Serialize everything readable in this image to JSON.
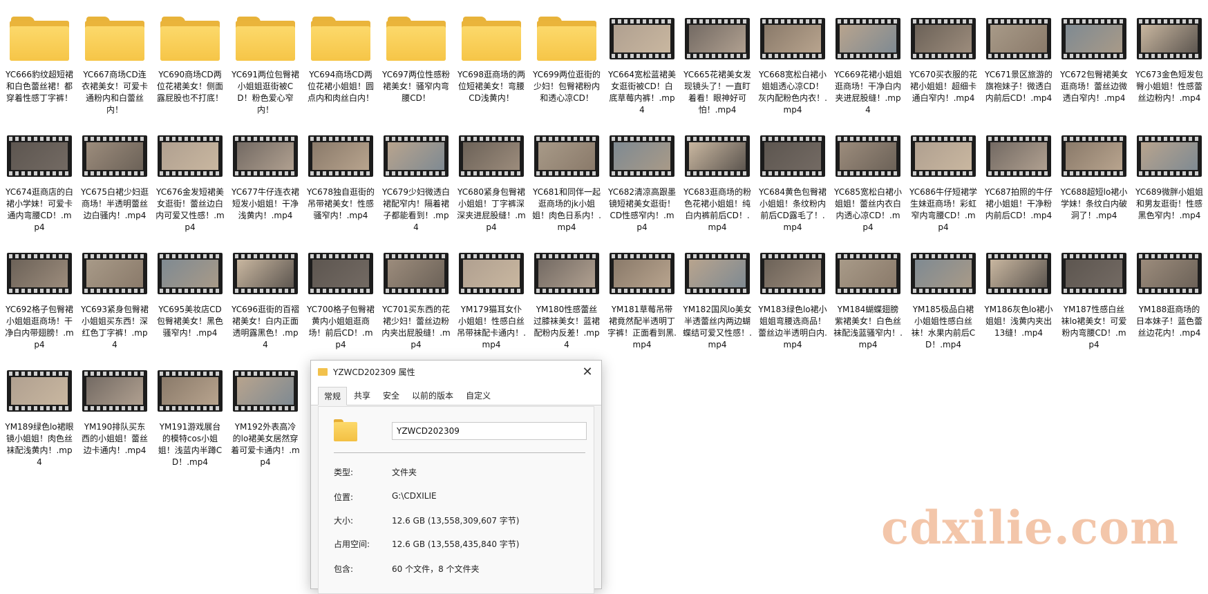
{
  "colors": {
    "folder": "#f6c547",
    "film": "#1c1c1c",
    "watermark": "#f2c0a1"
  },
  "items": [
    {
      "type": "folder",
      "label": "YC666豹纹超短裙和白色蕾丝裙！都穿着性感丁字裤！"
    },
    {
      "type": "folder",
      "label": "YC667商场CD连衣裙美女！可爱卡通粉内和白蕾丝内！"
    },
    {
      "type": "folder",
      "label": "YC690商场CD两位花裙美女！侧面露屁股也不打底！"
    },
    {
      "type": "folder",
      "label": "YC691两位包臀裙小姐姐逛街被CD！粉色爱心窄内！"
    },
    {
      "type": "folder",
      "label": "YC694商场CD两位花裙小姐姐！圆点内和肉丝白内！"
    },
    {
      "type": "folder",
      "label": "YC697两位性感粉裙美女！骚窄内弯腰CD！"
    },
    {
      "type": "folder",
      "label": "YC698逛商场的两位短裙美女！弯腰CD浅黄内！"
    },
    {
      "type": "folder",
      "label": "YC699两位逛街的少妇！包臀裙粉内和透心凉CD！"
    },
    {
      "type": "video",
      "label": "YC664宽松蓝裙美女逛街被CD！白底草莓内裤！.mp4"
    },
    {
      "type": "video",
      "label": "YC665花裙美女发现镜头了！一直盯着看！眼神好可怕！.mp4"
    },
    {
      "type": "video",
      "label": "YC668宽松白裙小姐姐透心凉CD！灰内配粉色内衣！.mp4"
    },
    {
      "type": "video",
      "label": "YC669花裙小姐姐逛商场！干净白内夹进屁股缝！.mp4"
    },
    {
      "type": "video",
      "label": "YC670买衣服的花裙小姐姐！超细卡通白窄内！.mp4"
    },
    {
      "type": "video",
      "label": "YC671景区旅游的旗袍妹子！微透白内前后CD！.mp4"
    },
    {
      "type": "video",
      "label": "YC672包臀裙美女逛商场！蕾丝边微透白窄内！.mp4"
    },
    {
      "type": "video",
      "label": "YC673金色短发包臀小姐姐！性感蕾丝边粉内！.mp4"
    },
    {
      "type": "video",
      "label": "YC674逛商店的白裙小学妹！可爱卡通内弯腰CD！.mp4"
    },
    {
      "type": "video",
      "label": "YC675白裙少妇逛商场！半透明蕾丝边白骚内！.mp4"
    },
    {
      "type": "video",
      "label": "YC676金发短裙美女逛街！蕾丝边白内可爱又性感！.mp4"
    },
    {
      "type": "video",
      "label": "YC677牛仔连衣裙短发小姐姐！干净浅黄内！.mp4"
    },
    {
      "type": "video",
      "label": "YC678独自逛街的吊带裙美女！性感骚窄内！.mp4"
    },
    {
      "type": "video",
      "label": "YC679少妇微透白裙配窄内！隔着裙子都能看到！.mp4"
    },
    {
      "type": "video",
      "label": "YC680紧身包臀裙小姐姐！丁字裤深深夹进屁股缝！.mp4"
    },
    {
      "type": "video",
      "label": "YC681和同伴一起逛商场的jk小姐姐！肉色日系内！.mp4"
    },
    {
      "type": "video",
      "label": "YC682清凉高跟墨镜短裙美女逛街！CD性感窄内！.mp4"
    },
    {
      "type": "video",
      "label": "YC683逛商场的粉色花裙小姐姐！纯白内裤前后CD！.mp4"
    },
    {
      "type": "video",
      "label": "YC684黄色包臀裙小姐姐！条纹粉内前后CD露毛了！.mp4"
    },
    {
      "type": "video",
      "label": "YC685宽松白裙小姐姐！蕾丝内衣白内透心凉CD！.mp4"
    },
    {
      "type": "video",
      "label": "YC686牛仔短裙学生妹逛商场！彩虹窄内弯腰CD！.mp4"
    },
    {
      "type": "video",
      "label": "YC687拍照的牛仔裙小姐姐！干净粉内前后CD！.mp4"
    },
    {
      "type": "video",
      "label": "YC688超短lo裙小学妹！条纹白内破洞了！.mp4"
    },
    {
      "type": "video",
      "label": "YC689微胖小姐姐和男友逛街！性感黑色窄内！.mp4"
    },
    {
      "type": "video",
      "label": "YC692格子包臀裙小姐姐逛商场！干净白内带翅膀！.mp4"
    },
    {
      "type": "video",
      "label": "YC693紧身包臀裙小姐姐买东西！深红色丁字裤！.mp4"
    },
    {
      "type": "video",
      "label": "YC695美妆店CD包臀裙美女！黑色骚窄内！.mp4"
    },
    {
      "type": "video",
      "label": "YC696逛街的百褶裙美女！白内正面透明露黑色！.mp4"
    },
    {
      "type": "video",
      "label": "YC700格子包臀裙黄内小姐姐逛商场！前后CD！.mp4"
    },
    {
      "type": "video",
      "label": "YC701买东西的花裙少妇！蕾丝边粉内夹出屁股缝！.mp4"
    },
    {
      "type": "video",
      "label": "YM179猫耳女仆小姐姐！性感白丝吊带袜配卡通内！.mp4"
    },
    {
      "type": "video",
      "label": "YM180性感蕾丝过膝袜美女！蓝裙配粉内反差！.mp4"
    },
    {
      "type": "video",
      "label": "YM181草莓吊带裙竟然配半透明丁字裤！正面看到黑.mp4"
    },
    {
      "type": "video",
      "label": "YM182国风lo美女半透蕾丝内两边蝴蝶结可爱又性感！.mp4"
    },
    {
      "type": "video",
      "label": "YM183绿色lo裙小姐姐弯腰选商品！蕾丝边半透明白内.mp4"
    },
    {
      "type": "video",
      "label": "YM184蝴蝶翅膀紫裙美女！白色丝袜配浅蓝骚窄内！.mp4"
    },
    {
      "type": "video",
      "label": "YM185极品白裙小姐姐性感白丝袜！水果内前后CD！.mp4"
    },
    {
      "type": "video",
      "label": "YM186灰色lo裙小姐姐！浅黄内夹出13缝！.mp4"
    },
    {
      "type": "video",
      "label": "YM187性感白丝袜lo裙美女！可爱粉内弯腰CD！.mp4"
    },
    {
      "type": "video",
      "label": "YM188逛商场的日本妹子！蓝色蕾丝边花内！.mp4"
    },
    {
      "type": "video",
      "label": "YM189绿色lo裙眼镜小姐姐！肉色丝袜配浅黄内！.mp4"
    },
    {
      "type": "video",
      "label": "YM190排队买东西的小姐姐！蕾丝边卡通内！.mp4"
    },
    {
      "type": "video",
      "label": "YM191游戏展台的模特cos小姐姐！浅蓝内半蹲CD！.mp4"
    },
    {
      "type": "video",
      "label": "YM192外表高冷的lo裙美女居然穿着可爱卡通内！.mp4"
    }
  ],
  "dialog": {
    "title": "YZWCD202309 属性",
    "close": "✕",
    "tabs": [
      "常规",
      "共享",
      "安全",
      "以前的版本",
      "自定义"
    ],
    "name_value": "YZWCD202309",
    "rows": [
      {
        "label": "类型:",
        "value": "文件夹"
      },
      {
        "label": "位置:",
        "value": "G:\\CDXILIE"
      },
      {
        "label": "大小:",
        "value": "12.6 GB (13,558,309,607 字节)"
      },
      {
        "label": "占用空间:",
        "value": "12.6 GB (13,558,435,840 字节)"
      },
      {
        "label": "包含:",
        "value": "60 个文件，8 个文件夹"
      }
    ]
  },
  "watermark": "cdxilie.com"
}
